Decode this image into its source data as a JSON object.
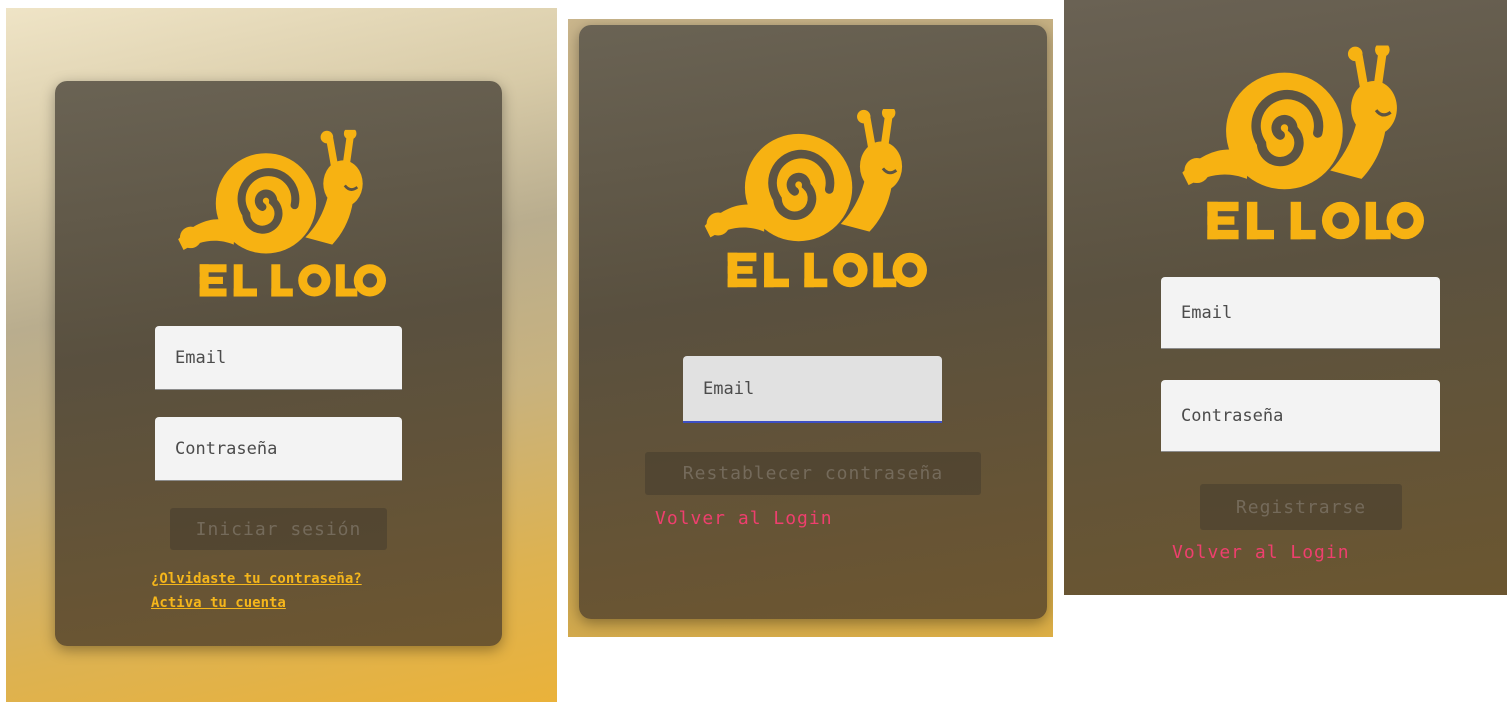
{
  "brand": {
    "name": "EL LOLO",
    "color": "#F7B212"
  },
  "login": {
    "email_placeholder": "Email",
    "password_placeholder": "Contraseña",
    "submit_label": "Iniciar sesión",
    "forgot_link": "¿Olvidaste tu contraseña?",
    "activate_link": "Activa tu cuenta"
  },
  "reset": {
    "email_placeholder": "Email",
    "submit_label": "Restablecer contraseña",
    "back_link": "Volver al Login"
  },
  "register": {
    "email_placeholder": "Email",
    "password_placeholder": "Contraseña",
    "submit_label": "Registrarse",
    "back_link": "Volver al Login"
  }
}
